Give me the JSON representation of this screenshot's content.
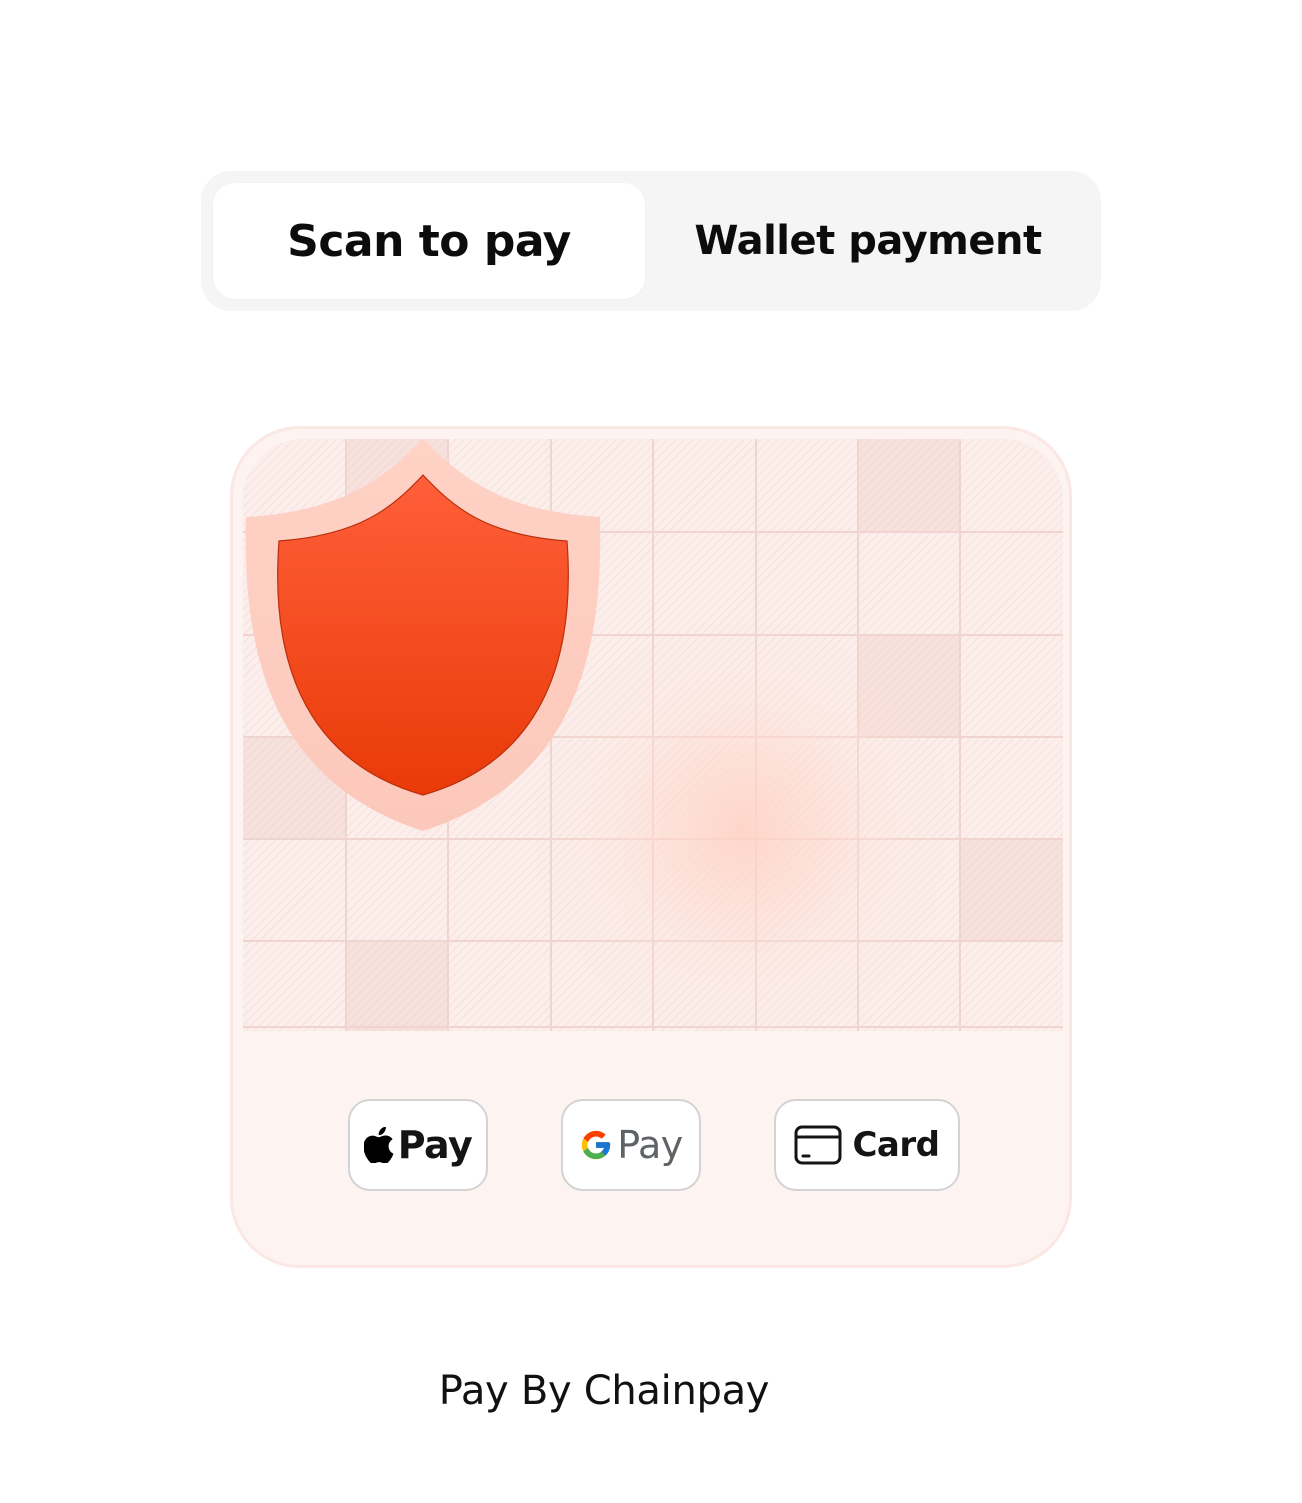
{
  "tabs": [
    {
      "label": "Scan to pay",
      "active": true
    },
    {
      "label": "Wallet payment",
      "active": false
    }
  ],
  "payment_methods": [
    {
      "label": "Pay",
      "icon": "apple-icon"
    },
    {
      "label": "Pay",
      "icon": "google-g-icon"
    },
    {
      "label": "Card",
      "icon": "credit-card-icon"
    }
  ],
  "illustration": {
    "icon": "shield-icon",
    "accent_color": "#f04a1e"
  },
  "footer": {
    "text": "Pay By Chainpay"
  }
}
